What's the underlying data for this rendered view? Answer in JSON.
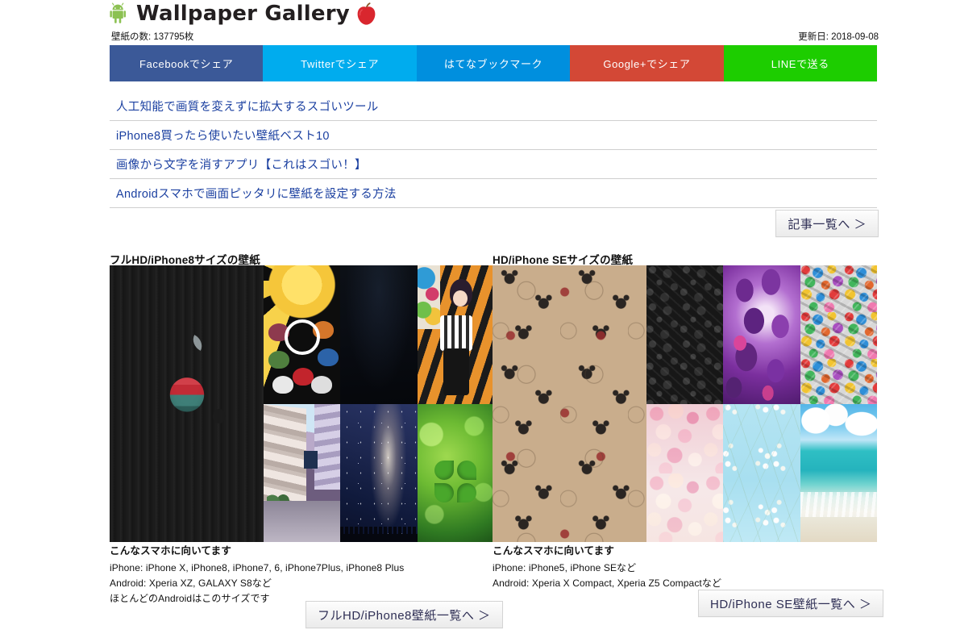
{
  "header": {
    "title": "Wallpaper Gallery",
    "android_icon": "android-robot-icon",
    "apple_icon": "apple-fruit-icon",
    "count_text": "壁紙の数: 137795枚",
    "update_text": "更新日: 2018-09-08"
  },
  "share_buttons": [
    {
      "label": "Facebookでシェア",
      "color": "#3b5998",
      "name": "share-facebook"
    },
    {
      "label": "Twitterでシェア",
      "color": "#00acee",
      "name": "share-twitter"
    },
    {
      "label": "はてなブックマーク",
      "color": "#008fde",
      "name": "share-hatena"
    },
    {
      "label": "Google+でシェア",
      "color": "#d34836",
      "name": "share-googleplus"
    },
    {
      "label": "LINEで送る",
      "color": "#1dcd00",
      "name": "share-line"
    }
  ],
  "articles": [
    {
      "label": "人工知能で画質を変えずに拡大するスゴいツール"
    },
    {
      "label": "iPhone8買ったら使いたい壁紙ベスト10"
    },
    {
      "label": "画像から文字を消すアプリ【これはスゴい！】"
    },
    {
      "label": "Androidスマホで画面ピッタリに壁紙を設定する方法"
    }
  ],
  "articles_more_label": "記事一覧へ ＞",
  "galleries": [
    {
      "heading": "フルHD/iPhone8サイズの壁紙",
      "hero": {
        "art": "art-leather",
        "alt": "apple-logo-on-leather-wallpaper"
      },
      "thumbs": [
        {
          "art": "art-sunburst",
          "alt": "naruto-sunburst-wallpaper"
        },
        {
          "art": "art-darknavy",
          "alt": "dark-navy-gradient-wallpaper"
        },
        {
          "art": "art-animegirl",
          "alt": "anime-girl-tiger-wallpaper"
        },
        {
          "art": "art-city",
          "alt": "city-street-wallpaper"
        },
        {
          "art": "art-galaxy",
          "alt": "milky-way-galaxy-wallpaper"
        },
        {
          "art": "art-clover",
          "alt": "green-clover-wallpaper"
        }
      ],
      "caption_title": "こんなスマホに向いてます",
      "caption_lines": [
        "iPhone: iPhone X, iPhone8, iPhone7, 6, iPhone7Plus, iPhone8 Plus",
        "Android: Xperia XZ, GALAXY S8など",
        "ほとんどのAndroidはこのサイズです"
      ],
      "more_label": "フルHD/iPhone8壁紙一覧へ ＞"
    },
    {
      "heading": "HD/iPhone SEサイズの壁紙",
      "hero": {
        "art": "art-mickey",
        "alt": "mickey-mouse-pattern-wallpaper"
      },
      "thumbs": [
        {
          "art": "art-doodle",
          "alt": "dark-doodle-pattern-wallpaper"
        },
        {
          "art": "art-purple",
          "alt": "purple-leaves-wallpaper"
        },
        {
          "art": "art-sticker",
          "alt": "sticker-bomb-wallpaper"
        },
        {
          "art": "art-floral",
          "alt": "pink-floral-wall-wallpaper"
        },
        {
          "art": "art-babyblue",
          "alt": "baby-blue-gypsophila-wallpaper"
        },
        {
          "art": "art-beach",
          "alt": "tropical-beach-wallpaper"
        }
      ],
      "caption_title": "こんなスマホに向いてます",
      "caption_lines": [
        "iPhone: iPhone5, iPhone SEなど",
        "Android: Xperia X Compact, Xperia Z5 Compactなど"
      ],
      "more_label": "HD/iPhone SE壁紙一覧へ ＞"
    }
  ]
}
